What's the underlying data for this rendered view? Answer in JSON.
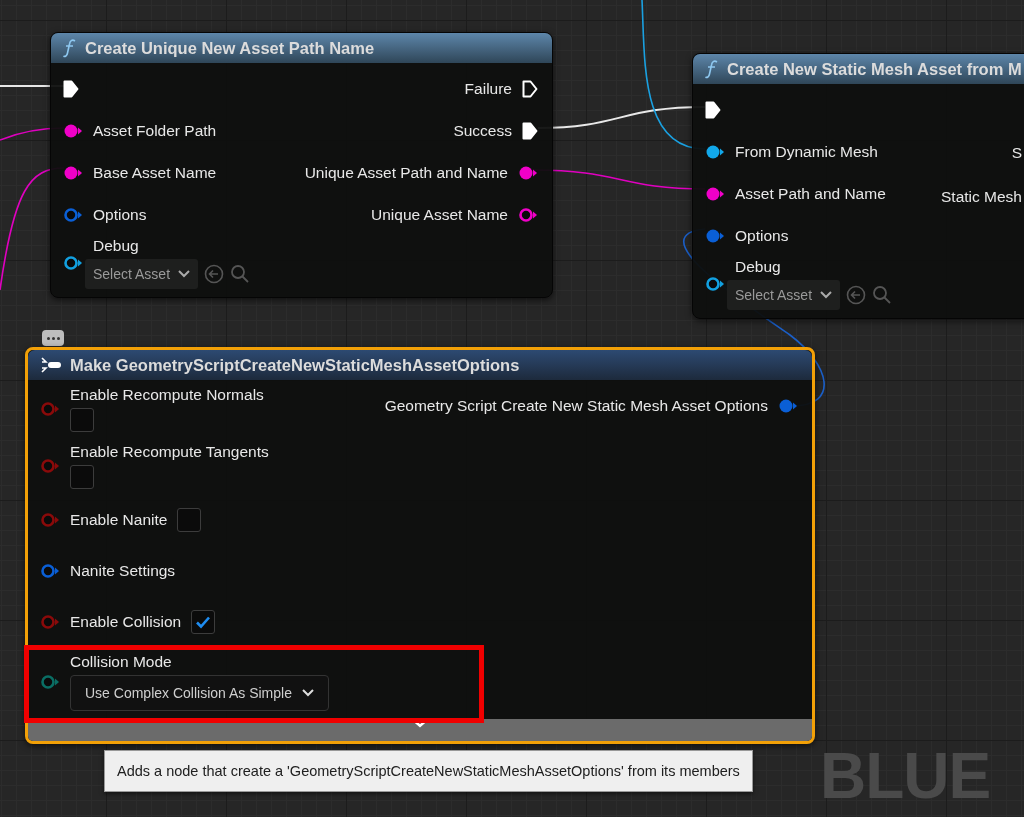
{
  "nodes": [
    {
      "title": "Create Unique New Asset Path Name",
      "kind": "function",
      "selected": false,
      "inputs": [
        {
          "kind": "exec",
          "connected": true,
          "color": "#ffffff"
        },
        {
          "label": "Asset Folder Path",
          "kind": "data",
          "connected": true,
          "color": "#f000c8"
        },
        {
          "label": "Base Asset Name",
          "kind": "data",
          "connected": true,
          "color": "#f000c8"
        },
        {
          "label": "Options",
          "kind": "data",
          "connected": false,
          "color": "#0a5fd6"
        },
        {
          "label": "Debug",
          "kind": "data",
          "connected": false,
          "color": "#12a0e0",
          "widget": {
            "kind": "asset",
            "value": "Select Asset"
          }
        }
      ],
      "outputs": [
        {
          "label": "Failure",
          "kind": "exec",
          "connected": false,
          "color": "#ffffff"
        },
        {
          "label": "Success",
          "kind": "exec",
          "connected": true,
          "color": "#ffffff"
        },
        {
          "label": "Unique Asset Path and Name",
          "kind": "data",
          "connected": true,
          "color": "#f000c8"
        },
        {
          "label": "Unique Asset Name",
          "kind": "data",
          "connected": false,
          "color": "#f000c8"
        }
      ]
    },
    {
      "title": "Create New Static Mesh Asset from M",
      "kind": "function",
      "selected": false,
      "inputs": [
        {
          "kind": "exec",
          "connected": true,
          "color": "#ffffff"
        },
        {
          "label": "From Dynamic Mesh",
          "kind": "data",
          "connected": true,
          "color": "#12a8ea"
        },
        {
          "label": "Asset Path and Name",
          "kind": "data",
          "connected": true,
          "color": "#f000c8"
        },
        {
          "label": "Options",
          "kind": "data",
          "connected": true,
          "color": "#0a5fd6"
        },
        {
          "label": "Debug",
          "kind": "data",
          "connected": false,
          "color": "#12a0e0",
          "widget": {
            "kind": "asset",
            "value": "Select Asset"
          }
        }
      ],
      "outputs": [
        {
          "label": "S",
          "kind": "label"
        },
        {
          "label": "Static Mesh",
          "kind": "label"
        }
      ]
    },
    {
      "title": "Make GeometryScriptCreateNewStaticMeshAssetOptions",
      "kind": "make",
      "selected": true,
      "collapsible": true,
      "tooltip": "Adds a node that create a 'GeometryScriptCreateNewStaticMeshAssetOptions' from its members",
      "inputs": [
        {
          "label": "Enable Recompute Normals",
          "kind": "data",
          "connected": false,
          "color": "#8a0a0a",
          "widget": {
            "kind": "stackedcheckbox",
            "checked": false
          }
        },
        {
          "label": "Enable Recompute Tangents",
          "kind": "data",
          "connected": false,
          "color": "#8a0a0a",
          "widget": {
            "kind": "stackedcheckbox",
            "checked": false
          }
        },
        {
          "label": "Enable Nanite",
          "kind": "data",
          "connected": false,
          "color": "#8a0a0a",
          "widget": {
            "kind": "checkbox",
            "checked": false
          }
        },
        {
          "label": "Nanite Settings",
          "kind": "data",
          "connected": false,
          "color": "#0a5fd6"
        },
        {
          "label": "Enable Collision",
          "kind": "data",
          "connected": false,
          "color": "#8a0a0a",
          "widget": {
            "kind": "checkbox",
            "checked": true
          }
        },
        {
          "label": "Collision Mode",
          "kind": "data",
          "connected": false,
          "color": "#0a6e64",
          "highlighted": true,
          "widget": {
            "kind": "dropdown",
            "value": "Use Complex Collision As Simple"
          }
        }
      ],
      "outputs": [
        {
          "label": "Geometry Script Create New Static Mesh Asset Options",
          "kind": "data",
          "connected": true,
          "color": "#0a5fd6"
        }
      ]
    }
  ],
  "graph_watermark": "BLUE"
}
